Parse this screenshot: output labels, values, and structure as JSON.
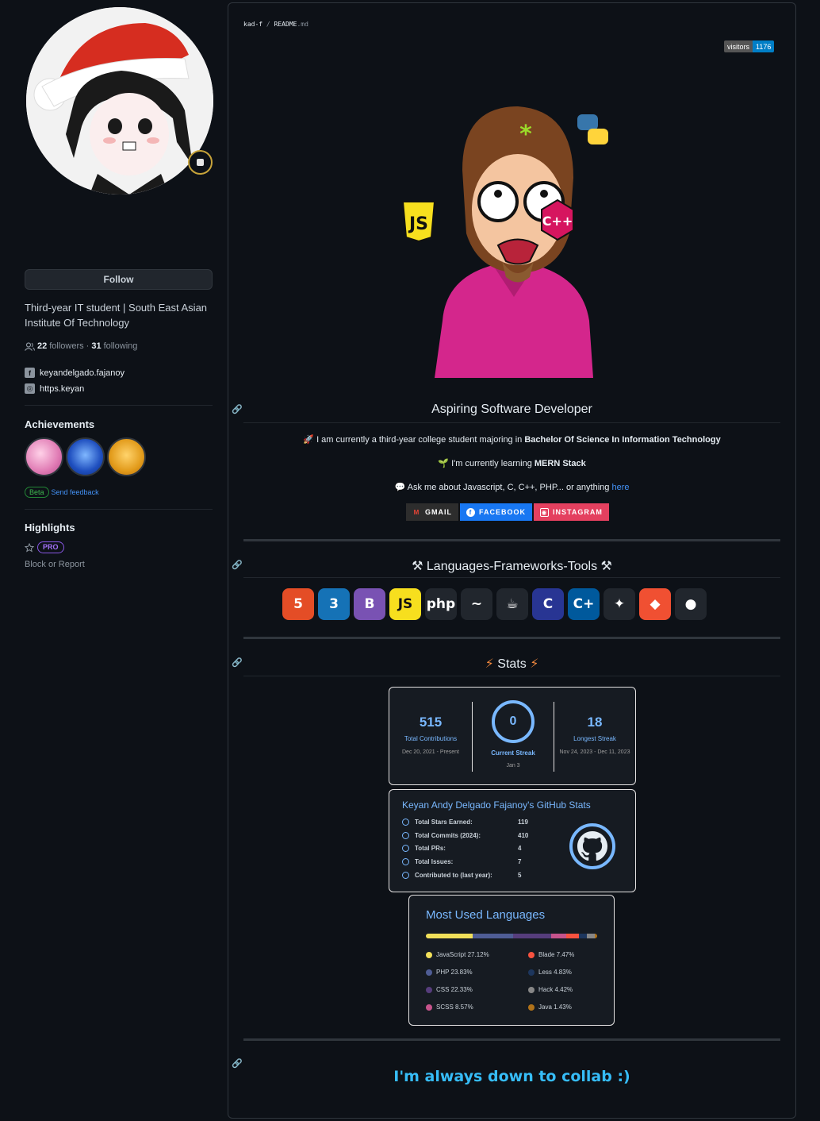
{
  "profile": {
    "follow_label": "Follow",
    "bio": "Third-year IT student | South East Asian Institute Of Technology",
    "followers_count": "22",
    "followers_label": "followers",
    "dot": "·",
    "following_count": "31",
    "following_label": "following",
    "facebook": "keyandelgado.fajanoy",
    "website": "https.keyan",
    "achievements_title": "Achievements",
    "beta_label": "Beta",
    "feedback_label": "Send feedback",
    "highlights_title": "Highlights",
    "pro_label": "PRO",
    "block_label": "Block or Report"
  },
  "readme": {
    "path_user": "kad-f",
    "path_sep": " / ",
    "path_file": "README",
    "path_ext": ".md",
    "visitors_label": "visitors",
    "visitors_count": "1176",
    "heading1": "Aspiring Software Developer",
    "line1_prefix": "I am currently a third-year college student majoring in",
    "line1_bold": "Bachelor Of Science In Information Technology",
    "line2_prefix": "I'm currently learning",
    "line2_bold": "MERN Stack",
    "line3_prefix": "Ask me about Javascript, C, C++, PHP... or anything",
    "line3_link": "here",
    "gmail_label": "GMAIL",
    "facebook_label": "FACEBOOK",
    "instagram_label": "INSTAGRAM",
    "heading2": "Languages-Frameworks-Tools",
    "heading3": "Stats",
    "collab": "I'm always down to collab :)"
  },
  "tools": [
    {
      "icon": "html5-icon",
      "glyph": "5",
      "color": "#e44d26"
    },
    {
      "icon": "css3-icon",
      "glyph": "3",
      "color": "#1572b6"
    },
    {
      "icon": "bootstrap-icon",
      "glyph": "B",
      "color": "#7952b3"
    },
    {
      "icon": "javascript-icon",
      "glyph": "JS",
      "color": "#f7df1e"
    },
    {
      "icon": "php-icon",
      "glyph": "php",
      "color": "#21262d"
    },
    {
      "icon": "mysql-icon",
      "glyph": "~",
      "color": "#21262d"
    },
    {
      "icon": "java-icon",
      "glyph": "☕",
      "color": "#21262d"
    },
    {
      "icon": "c-icon",
      "glyph": "C",
      "color": "#283593"
    },
    {
      "icon": "cplusplus-icon",
      "glyph": "C+",
      "color": "#00599c"
    },
    {
      "icon": "figma-icon",
      "glyph": "✦",
      "color": "#21262d"
    },
    {
      "icon": "git-icon",
      "glyph": "◆",
      "color": "#f05032"
    },
    {
      "icon": "github-icon",
      "glyph": "●",
      "color": "#21262d"
    }
  ],
  "streak": {
    "total": "515",
    "total_label": "Total Contributions",
    "total_range": "Dec 20, 2021 - Present",
    "current": "0",
    "current_label": "Current Streak",
    "current_range": "Jan 3",
    "longest": "18",
    "longest_label": "Longest Streak",
    "longest_range": "Nov 24, 2023 - Dec 11, 2023"
  },
  "gh_stats": {
    "title": "Keyan Andy Delgado Fajanoy's GitHub Stats",
    "rows": [
      {
        "label": "Total Stars Earned:",
        "value": "119"
      },
      {
        "label": "Total Commits (2024):",
        "value": "410"
      },
      {
        "label": "Total PRs:",
        "value": "4"
      },
      {
        "label": "Total Issues:",
        "value": "7"
      },
      {
        "label": "Contributed to (last year):",
        "value": "5"
      }
    ]
  },
  "languages": {
    "title": "Most Used Languages",
    "items": [
      {
        "name": "JavaScript 27.12%",
        "color": "#f1e05a",
        "pct": 27.12
      },
      {
        "name": "PHP 23.83%",
        "color": "#4f5d95",
        "pct": 23.83
      },
      {
        "name": "CSS 22.33%",
        "color": "#563d7c",
        "pct": 22.33
      },
      {
        "name": "SCSS 8.57%",
        "color": "#c6538c",
        "pct": 8.57
      },
      {
        "name": "Blade 7.47%",
        "color": "#f7523f",
        "pct": 7.47
      },
      {
        "name": "Less 4.83%",
        "color": "#1d365d",
        "pct": 4.83
      },
      {
        "name": "Hack 4.42%",
        "color": "#878787",
        "pct": 4.42
      },
      {
        "name": "Java 1.43%",
        "color": "#b07219",
        "pct": 1.43
      }
    ]
  }
}
